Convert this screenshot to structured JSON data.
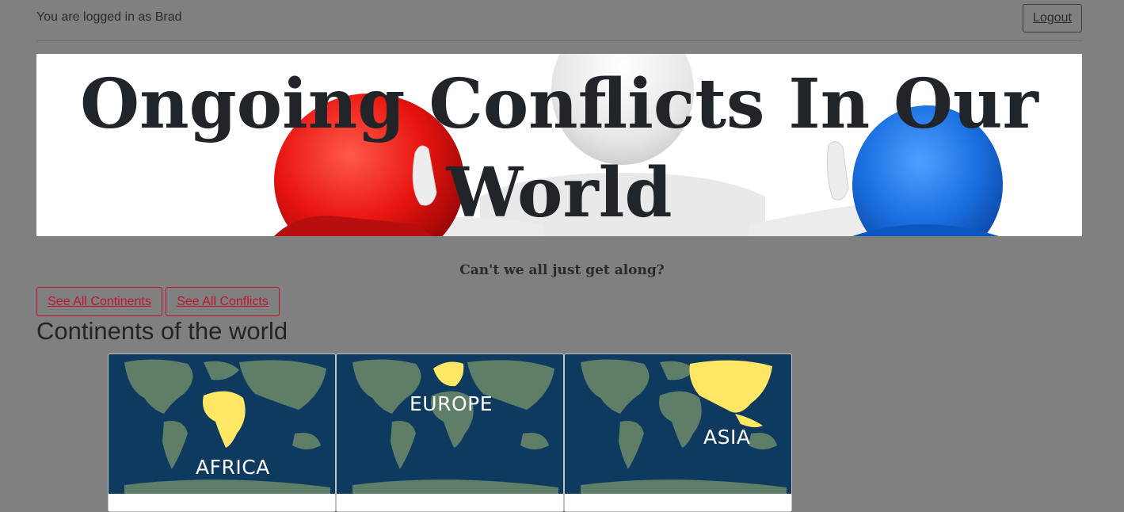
{
  "header": {
    "logged_in_text": "You are logged in as Brad",
    "logout_label": "Logout"
  },
  "hero": {
    "title": "Ongoing Conflicts In Our World"
  },
  "tagline": "Can't we all just get along?",
  "nav_buttons": {
    "continents_label": "See All Continents",
    "conflicts_label": "See All Conflicts"
  },
  "section": {
    "heading": "Continents of the world"
  },
  "cards": [
    {
      "label": "AFRICA"
    },
    {
      "label": "EUROPE"
    },
    {
      "label": "ASIA"
    }
  ],
  "colors": {
    "overlay_background": "#808080",
    "button_accent": "#c0142d",
    "map_ocean": "#0e3a5f",
    "map_land": "#5e7e68",
    "map_highlight": "#ffe766"
  }
}
